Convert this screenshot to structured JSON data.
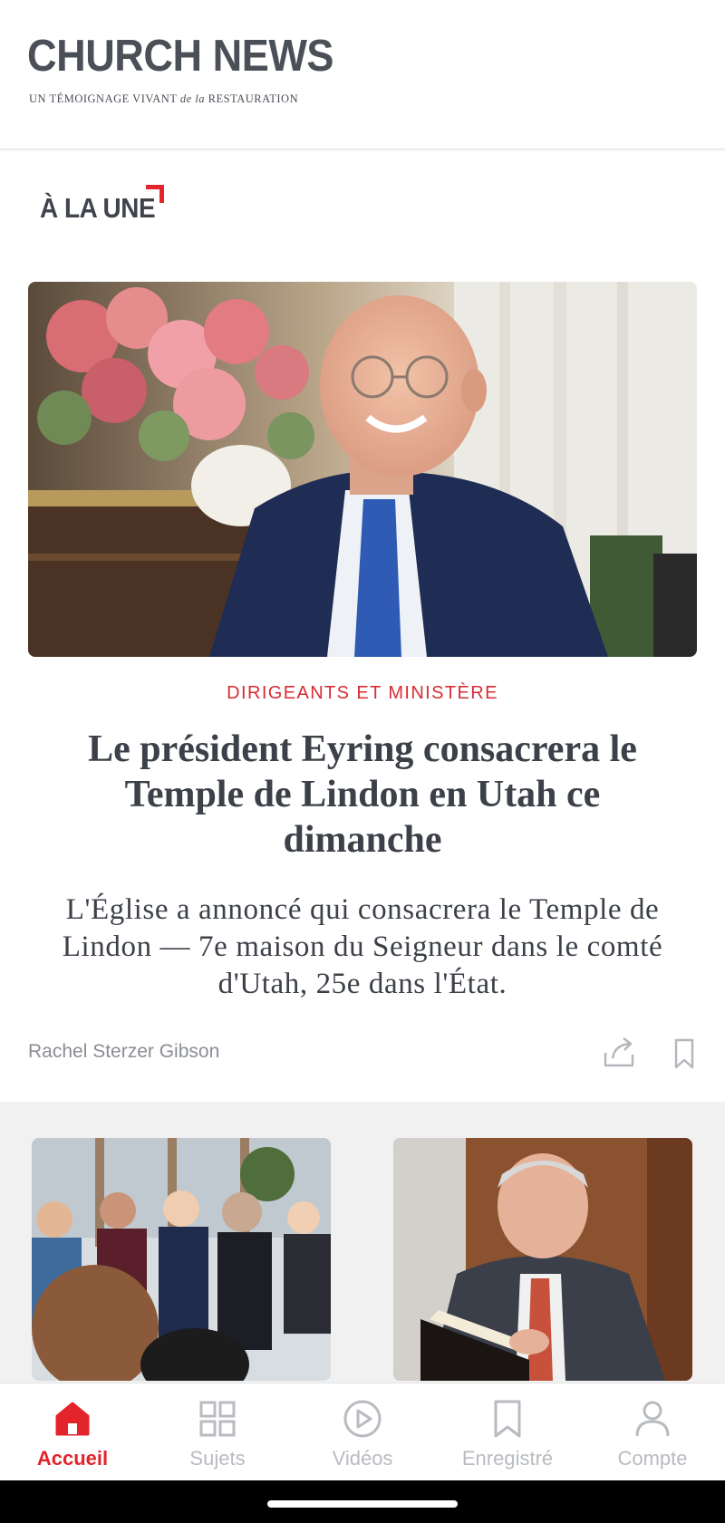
{
  "header": {
    "logo_title": "CHURCH NEWS",
    "tagline_a": "UN TÉMOIGNAGE VIVANT",
    "tagline_b": "de la",
    "tagline_c": "RESTAURATION"
  },
  "section": {
    "heading": "À LA UNE"
  },
  "featured": {
    "category": "DIRIGEANTS ET MINISTÈRE",
    "headline": "Le président Eyring consacrera le Temple de Lindon en Utah ce dimanche",
    "summary": "L'Église a annoncé qui consacrera le Temple de Lindon  — 7e maison du Seigneur dans le comté d'Utah, 25e dans l'État.",
    "author": "Rachel Sterzer Gibson"
  },
  "nav": {
    "items": [
      {
        "label": "Accueil",
        "icon": "home-icon",
        "active": true
      },
      {
        "label": "Sujets",
        "icon": "grid-icon",
        "active": false
      },
      {
        "label": "Vidéos",
        "icon": "play-icon",
        "active": false
      },
      {
        "label": "Enregistré",
        "icon": "bookmark-icon",
        "active": false
      },
      {
        "label": "Compte",
        "icon": "person-icon",
        "active": false
      }
    ]
  },
  "colors": {
    "accent": "#e3242b",
    "text": "#3c4048",
    "muted": "#b8bbc0"
  }
}
